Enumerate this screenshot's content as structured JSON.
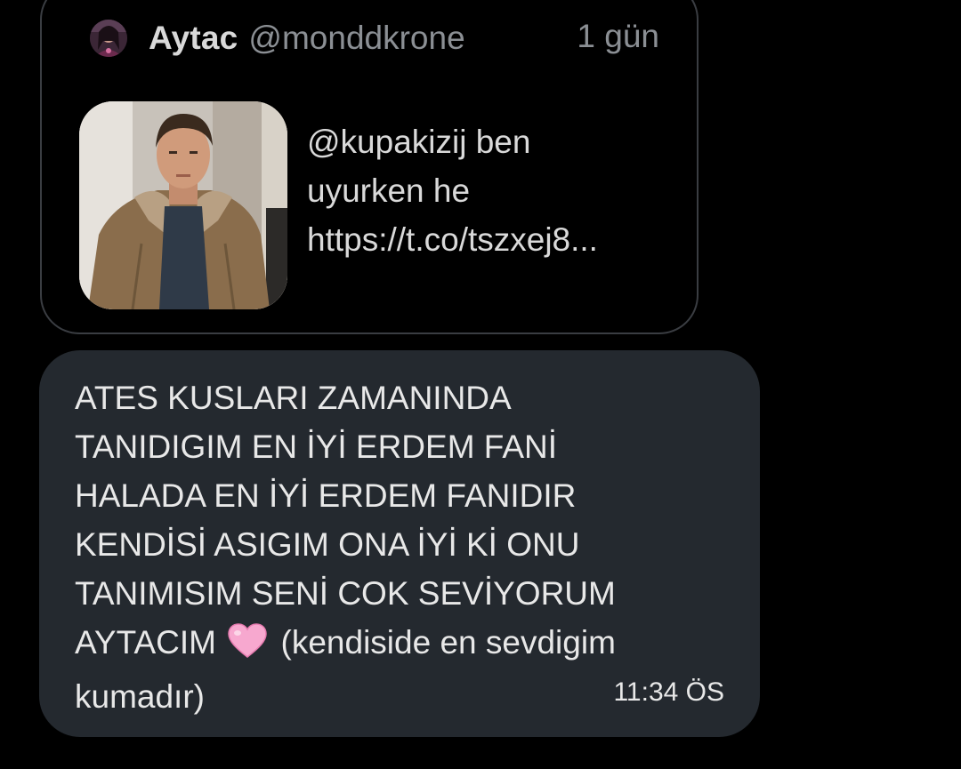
{
  "quoted_tweet": {
    "author_name": "Aytac",
    "author_handle": "@monddkrone",
    "time": "1 gün",
    "text_lines": [
      "@kupakizij ben",
      "uyurken he",
      "https://t.co/tszxej8..."
    ],
    "avatar_icon": "profile-photo",
    "thumbnail_icon": "photo-man-in-coat"
  },
  "message": {
    "lines": [
      "ATES KUSLARI ZAMANINDA",
      "TANIDIGIM EN İYİ ERDEM FANİ",
      "HALADA EN İYİ ERDEM FANIDIR",
      "KENDİSİ ASIGIM ONA İYİ Kİ ONU",
      "TANIMISIM SENİ COK SEVİYORUM"
    ],
    "line6_before_emoji": "AYTACIM",
    "emoji_icon": "pink-heart-icon",
    "line6_after_emoji": "(kendiside en sevdigim",
    "line7": "kumadır)",
    "time": "11:34 ÖS"
  },
  "colors": {
    "background": "#000000",
    "card_border": "#3a3d42",
    "bubble_bg": "#24292f",
    "primary_text": "#e8e8e8",
    "secondary_text": "#8b8f94",
    "heart": "#f7a8cf"
  }
}
